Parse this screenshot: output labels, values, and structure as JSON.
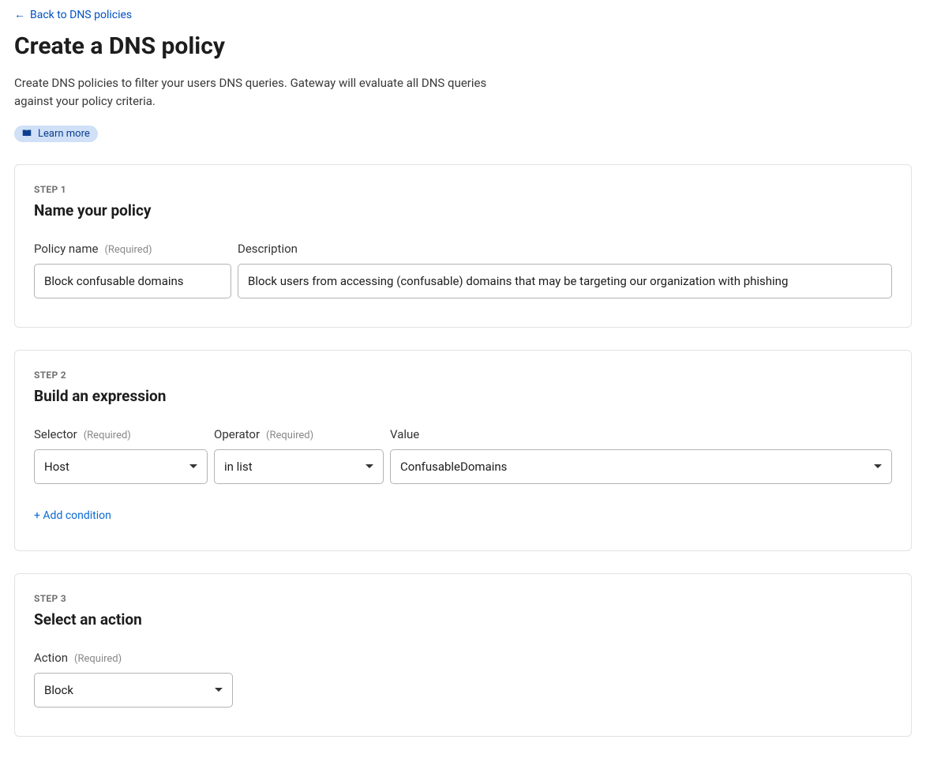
{
  "back_link": "Back to DNS policies",
  "title": "Create a DNS policy",
  "description": "Create DNS policies to filter your users DNS queries. Gateway will evaluate all DNS queries against your policy criteria.",
  "learn_more": "Learn more",
  "required_tag": "(Required)",
  "step1": {
    "step_label": "STEP 1",
    "heading": "Name your policy",
    "policy_name_label": "Policy name",
    "policy_name_value": "Block confusable domains",
    "description_label": "Description",
    "description_value": "Block users from accessing (confusable) domains that may be targeting our organization with phishing"
  },
  "step2": {
    "step_label": "STEP 2",
    "heading": "Build an expression",
    "selector_label": "Selector",
    "selector_value": "Host",
    "operator_label": "Operator",
    "operator_value": "in list",
    "value_label": "Value",
    "value_value": "ConfusableDomains",
    "add_condition": "+ Add condition"
  },
  "step3": {
    "step_label": "STEP 3",
    "heading": "Select an action",
    "action_label": "Action",
    "action_value": "Block"
  }
}
